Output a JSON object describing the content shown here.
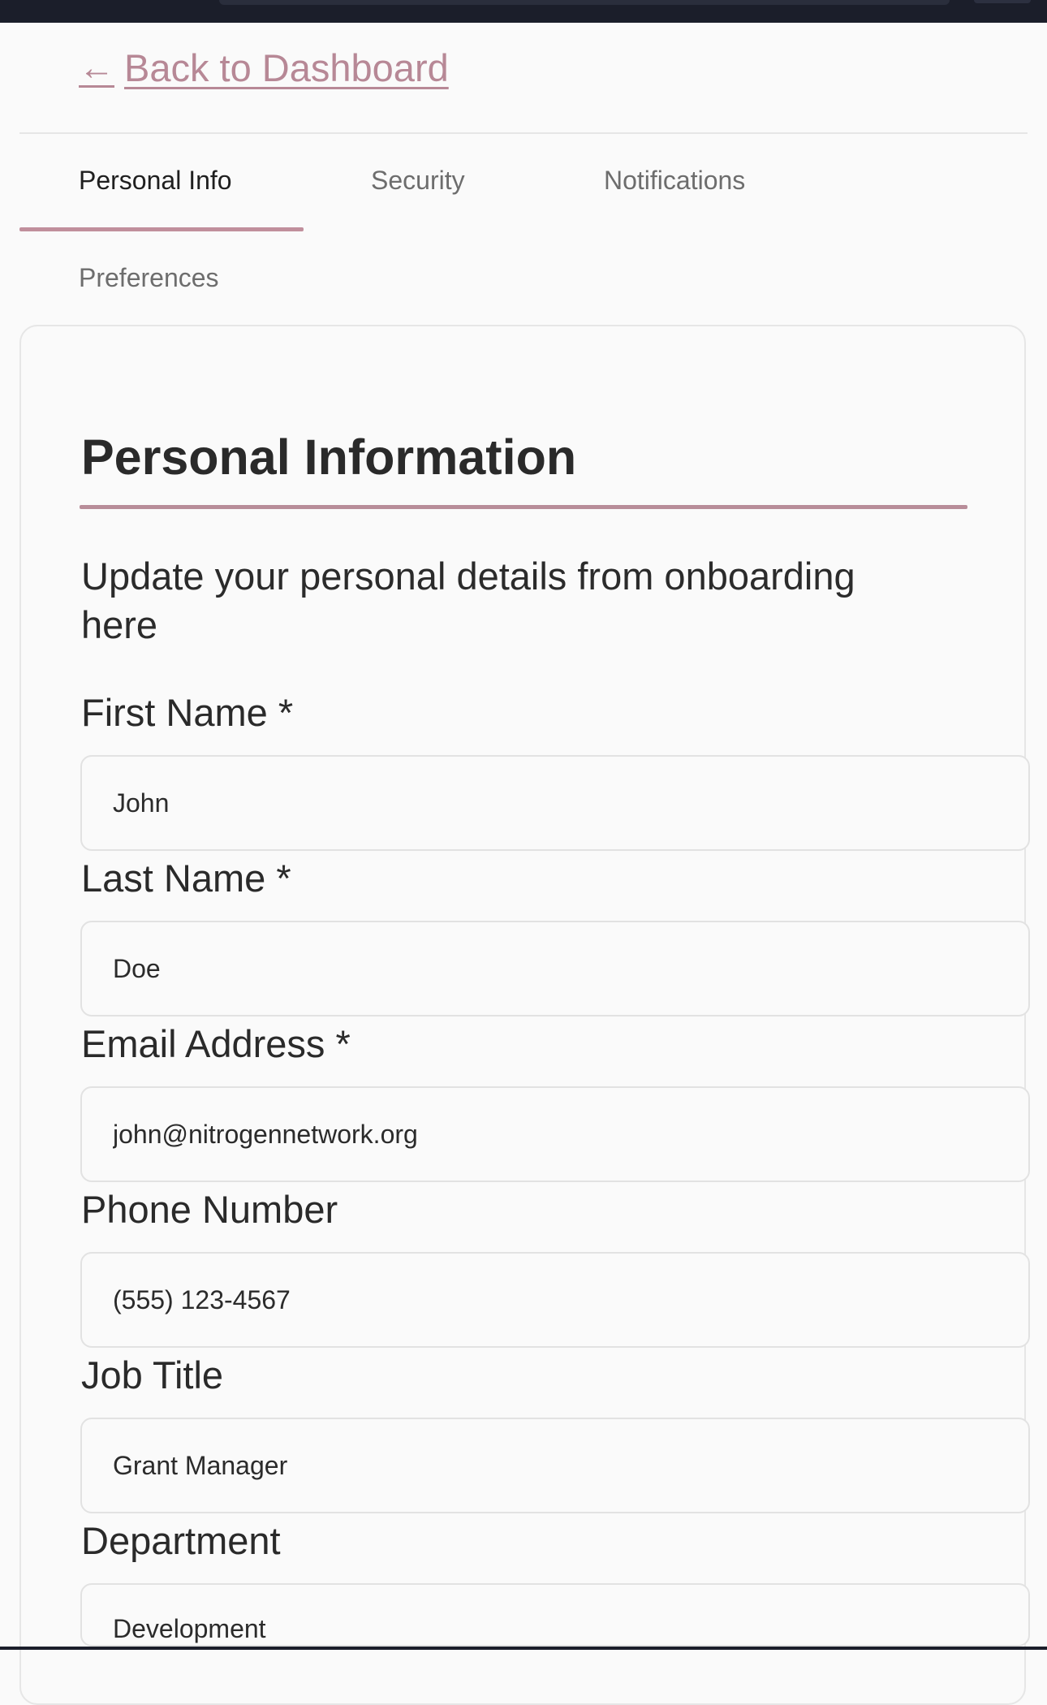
{
  "nav": {
    "back_link": "Back to Dashboard"
  },
  "tabs": [
    {
      "label": "Personal Info",
      "active": true
    },
    {
      "label": "Security",
      "active": false
    },
    {
      "label": "Notifications",
      "active": false
    },
    {
      "label": "Preferences",
      "active": false
    }
  ],
  "section": {
    "title": "Personal Information",
    "subtitle": "Update your personal details from onboarding here"
  },
  "fields": [
    {
      "label": "First Name *",
      "value": "John"
    },
    {
      "label": "Last Name *",
      "value": "Doe"
    },
    {
      "label": "Email Address *",
      "value": "john@nitrogennetwork.org"
    },
    {
      "label": "Phone Number",
      "value": "(555) 123-4567"
    },
    {
      "label": "Job Title",
      "value": "Grant Manager"
    },
    {
      "label": "Department",
      "value": "Development"
    }
  ],
  "colors": {
    "accent": "#b78896",
    "top_bar": "#1b1e2a",
    "background": "#fafafa"
  },
  "icons": {
    "back": "arrow-left-icon"
  }
}
